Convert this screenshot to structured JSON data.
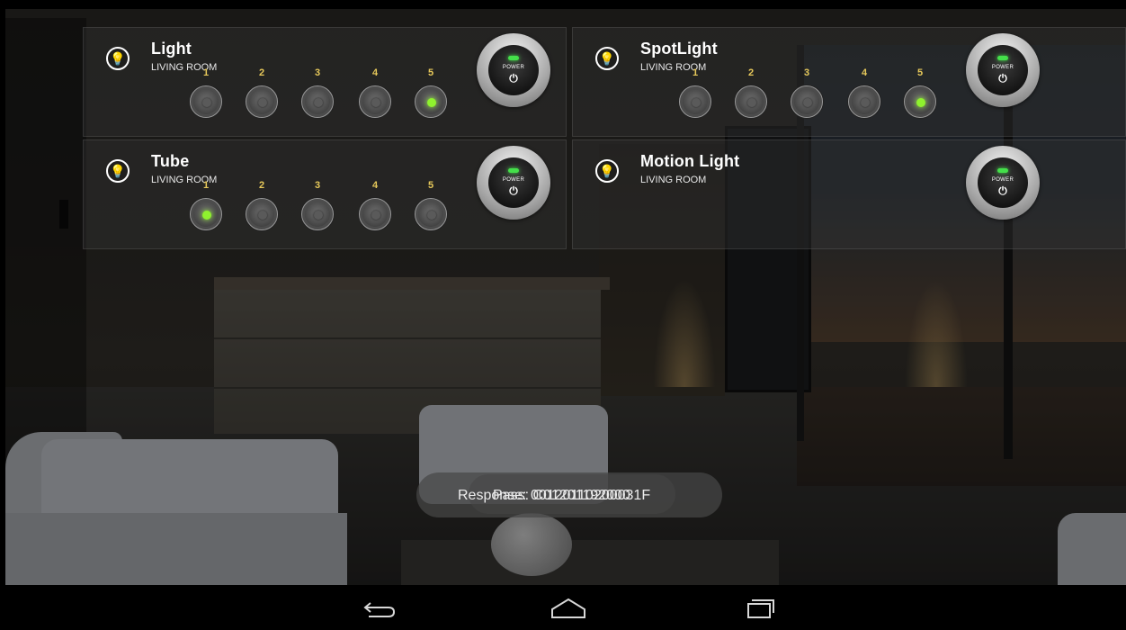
{
  "panels": [
    {
      "title": "Light",
      "subtitle": "LIVING ROOM",
      "icon": "lightbulb-icon",
      "levels": [
        {
          "label": "1",
          "active": false
        },
        {
          "label": "2",
          "active": false
        },
        {
          "label": "3",
          "active": false
        },
        {
          "label": "4",
          "active": false
        },
        {
          "label": "5",
          "active": true
        }
      ],
      "power_label": "POWER"
    },
    {
      "title": "SpotLight",
      "subtitle": "LIVING ROOM",
      "icon": "lightbulb-icon",
      "levels": [
        {
          "label": "1",
          "active": false
        },
        {
          "label": "2",
          "active": false
        },
        {
          "label": "3",
          "active": false
        },
        {
          "label": "4",
          "active": false
        },
        {
          "label": "5",
          "active": true
        }
      ],
      "power_label": "POWER"
    },
    {
      "title": "Tube",
      "subtitle": "LIVING ROOM",
      "icon": "lightbulb-icon",
      "levels": [
        {
          "label": "1",
          "active": true
        },
        {
          "label": "2",
          "active": false
        },
        {
          "label": "3",
          "active": false
        },
        {
          "label": "4",
          "active": false
        },
        {
          "label": "5",
          "active": false
        }
      ],
      "power_label": "POWER"
    },
    {
      "title": "Motion Light",
      "subtitle": "LIVING ROOM",
      "icon": "lightbulb-icon",
      "levels": [],
      "power_label": "POWER"
    }
  ],
  "toasts": {
    "first": "Response: 00120110200031F",
    "second": "Pass: C01201192000"
  },
  "colors": {
    "level_active": "#8ff22e",
    "level_number": "#e6c85a",
    "power_led": "#44e04a"
  },
  "navigation": {
    "back_icon": "back-arrow-icon",
    "home_icon": "home-icon",
    "recents_icon": "recent-apps-icon"
  }
}
